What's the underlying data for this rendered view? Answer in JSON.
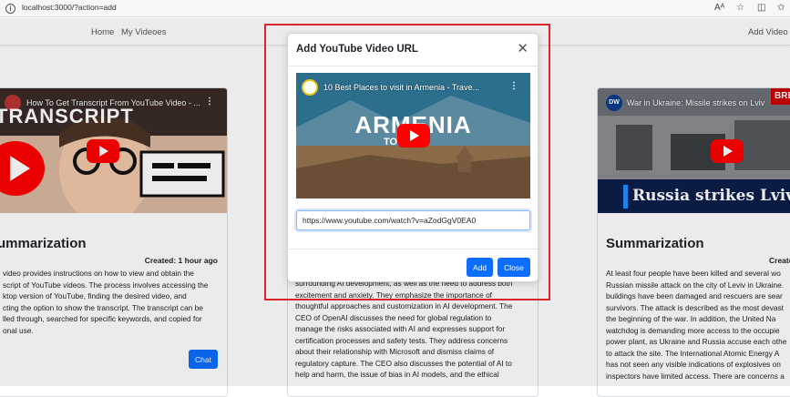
{
  "browser": {
    "url": "localhost:3000/?action=add",
    "icons": [
      "info-icon",
      "read-aloud-icon",
      "favorite-icon",
      "split-screen-icon",
      "favorites-bar-icon"
    ]
  },
  "navbar": {
    "home": "Home",
    "my_videos": "My Videoes",
    "add_video": "Add Video"
  },
  "modal": {
    "title": "Add YouTube Video URL",
    "preview": {
      "video_title": "10 Best Places to visit in Armenia - Trave...",
      "overlay_main": "ARMENIA",
      "overlay_sub": "TO DO"
    },
    "url_value": "https://www.youtube.com/watch?v=aZodGgV0EA0",
    "add_label": "Add",
    "close_label": "Close"
  },
  "cards": [
    {
      "video_title": "How To Get Transcript From YouTube Video - ...",
      "thumb_text": "TRANSCRIPT",
      "title": "ummarization",
      "created": "Created: 1 hour ago",
      "body_lines": [
        "video provides instructions on how to view and obtain the",
        "script of YouTube videos. The process involves accessing the",
        "ktop version of YouTube, finding the desired video, and",
        "cting the option to show the transcript. The transcript can be",
        "lled through, searched for specific keywords, and copied for",
        "onal use."
      ],
      "chat_label": "Chat"
    },
    {
      "body_lines": [
        "surrounding AI development, as well as the need to address both",
        "excitement and anxiety. They emphasize the importance of",
        "thoughtful approaches and customization in AI development. The",
        "CEO of OpenAI discusses the need for global regulation to",
        "manage the risks associated with AI and expresses support for",
        "certification processes and safety tests. They address concerns",
        "about their relationship with Microsoft and dismiss claims of",
        "regulatory capture. The CEO also discusses the potential of AI to",
        "help and harm, the issue of bias in AI models, and the ethical"
      ]
    },
    {
      "video_title": "War in Ukraine: Missile strikes on Lviv",
      "badge": "BREAKIN",
      "thumb_text": "Russia strikes Lviv",
      "title": "Summarization",
      "created": "Create",
      "body_lines": [
        "At least four people have been killed and several wo",
        "Russian missile attack on the city of Leviv in Ukraine.",
        "buildings have been damaged and rescuers are sear",
        "survivors. The attack is described as the most devast",
        "the beginning of the war. In addition, the United Na",
        "watchdog is demanding more access to the occupie",
        "power plant, as Ukraine and Russia accuse each othe",
        "to attack the site. The International Atomic Energy A",
        "has not seen any visible indications of explosives on",
        "inspectors have limited access. There are concerns a"
      ]
    }
  ],
  "colors": {
    "primary": "#0d6efd",
    "youtube_red": "#ff0000",
    "highlight": "#d9252b"
  }
}
